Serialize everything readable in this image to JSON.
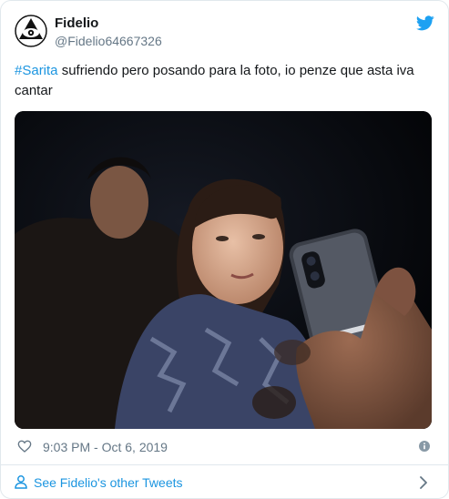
{
  "user": {
    "display_name": "Fidelio",
    "handle": "@Fidelio64667326",
    "avatar_icon": "eye-in-triangle-icon"
  },
  "tweet": {
    "hashtag": "#Sarita",
    "text": " sufriendo pero posando para la foto, io penze que asta iva cantar",
    "media_description_icon": "photo"
  },
  "meta": {
    "timestamp": "9:03 PM - Oct 6, 2019"
  },
  "footer": {
    "link_label": "See Fidelio's other Tweets"
  },
  "colors": {
    "link": "#1b95e0",
    "muted": "#657786",
    "text": "#14171a",
    "border": "#e1e8ed"
  }
}
